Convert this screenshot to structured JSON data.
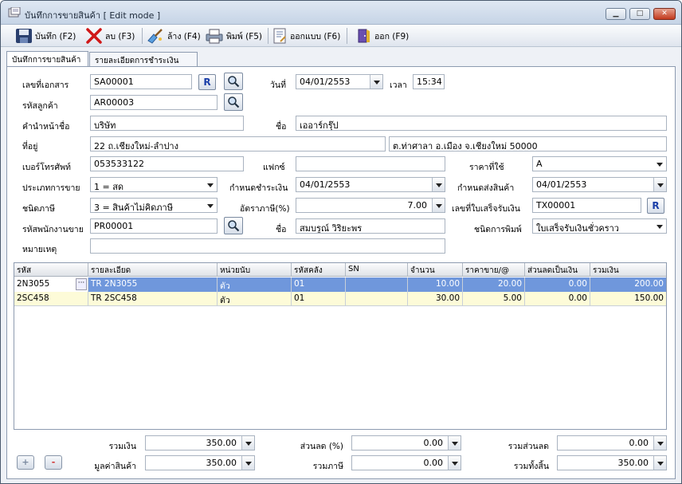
{
  "window": {
    "title": "บันทึกการขายสินค้า [ Edit mode ]",
    "minimize": "▁",
    "maximize": "□",
    "close": "✕"
  },
  "toolbar": {
    "save": "บันทึก (F2)",
    "delete": "ลบ (F3)",
    "clear": "ล้าง (F4)",
    "print": "พิมพ์ (F5)",
    "design": "ออกแบบ (F6)",
    "exit": "ออก (F9)"
  },
  "tabs": [
    "บันทึกการขายสินค้า",
    "รายละเอียดการชำระเงิน"
  ],
  "form": {
    "doc_no_label": "เลขที่เอกสาร",
    "doc_no": "SA00001",
    "r_button": "R",
    "date_label": "วันที่",
    "date": "04/01/2553",
    "time_label": "เวลา",
    "time": "15:34",
    "customer_code_label": "รหัสลูกค้า",
    "customer_code": "AR00003",
    "prefix_label": "คำนำหน้าชื่อ",
    "prefix": "บริษัท",
    "name_label": "ชื่อ",
    "name": "เออาร์กรุ๊ป",
    "address_label": "ที่อยู่",
    "address1": "22 ถ.เชียงใหม่-ลำปาง",
    "address2": "ต.ท่าศาลา อ.เมือง จ.เชียงใหม่ 50000",
    "phone_label": "เบอร์โทรศัพท์",
    "phone": "053533122",
    "fax_label": "แฟกซ์",
    "fax": "",
    "price_used_label": "ราคาที่ใช้",
    "price_used": "A",
    "sale_type_label": "ประเภทการขาย",
    "sale_type": "1 = สด",
    "payment_due_label": "กำหนดชำระเงิน",
    "payment_due": "04/01/2553",
    "delivery_due_label": "กำหนดส่งสินค้า",
    "delivery_due": "04/01/2553",
    "tax_type_label": "ชนิดภาษี",
    "tax_type": "3 = สินค้าไม่คิดภาษี",
    "tax_rate_label": "อัตราภาษี(%)",
    "tax_rate": "7.00",
    "receipt_no_label": "เลขที่ใบเสร็จรับเงิน",
    "receipt_no": "TX00001",
    "salesperson_label": "รหัสพนักงานขาย",
    "salesperson_code": "PR00001",
    "salesperson_name_label": "ชื่อ",
    "salesperson_name": "สมบรูณ์ วิริยะพร",
    "print_type_label": "ชนิดการพิมพ์",
    "print_type": "ใบเสร็จรับเงินชั่วคราว",
    "note_label": "หมายเหตุ",
    "note": ""
  },
  "grid": {
    "headers": [
      "รหัส",
      "รายละเอียด",
      "หน่วยนับ",
      "รหัสคลัง",
      "SN",
      "จำนวน",
      "ราคาขาย/@",
      "ส่วนลดเป็นเงิน",
      "รวมเงิน"
    ],
    "rows": [
      {
        "code": "2N3055",
        "desc": "TR 2N3055",
        "unit": "ตัว",
        "wh": "01",
        "sn": "",
        "qty": "10.00",
        "price": "20.00",
        "disc": "0.00",
        "total": "200.00",
        "ellipsis": "···"
      },
      {
        "code": "2SC458",
        "desc": "TR 2SC458",
        "unit": "ตัว",
        "wh": "01",
        "sn": "",
        "qty": "30.00",
        "price": "5.00",
        "disc": "0.00",
        "total": "150.00"
      }
    ]
  },
  "summary": {
    "sum_label": "รวมเงิน",
    "sum": "350.00",
    "discount_pct_label": "ส่วนลด (%)",
    "discount_pct": "0.00",
    "total_discount_label": "รวมส่วนลด",
    "total_discount": "0.00",
    "goods_value_label": "มูลค่าสินค้า",
    "goods_value": "350.00",
    "total_tax_label": "รวมภาษี",
    "total_tax": "0.00",
    "grand_total_label": "รวมทั้งสิ้น",
    "grand_total": "350.00",
    "add_button": "+",
    "remove_button": "-"
  },
  "colors": {
    "selected_row": "#6f97dc",
    "alt_row": "#fdfbd8"
  }
}
